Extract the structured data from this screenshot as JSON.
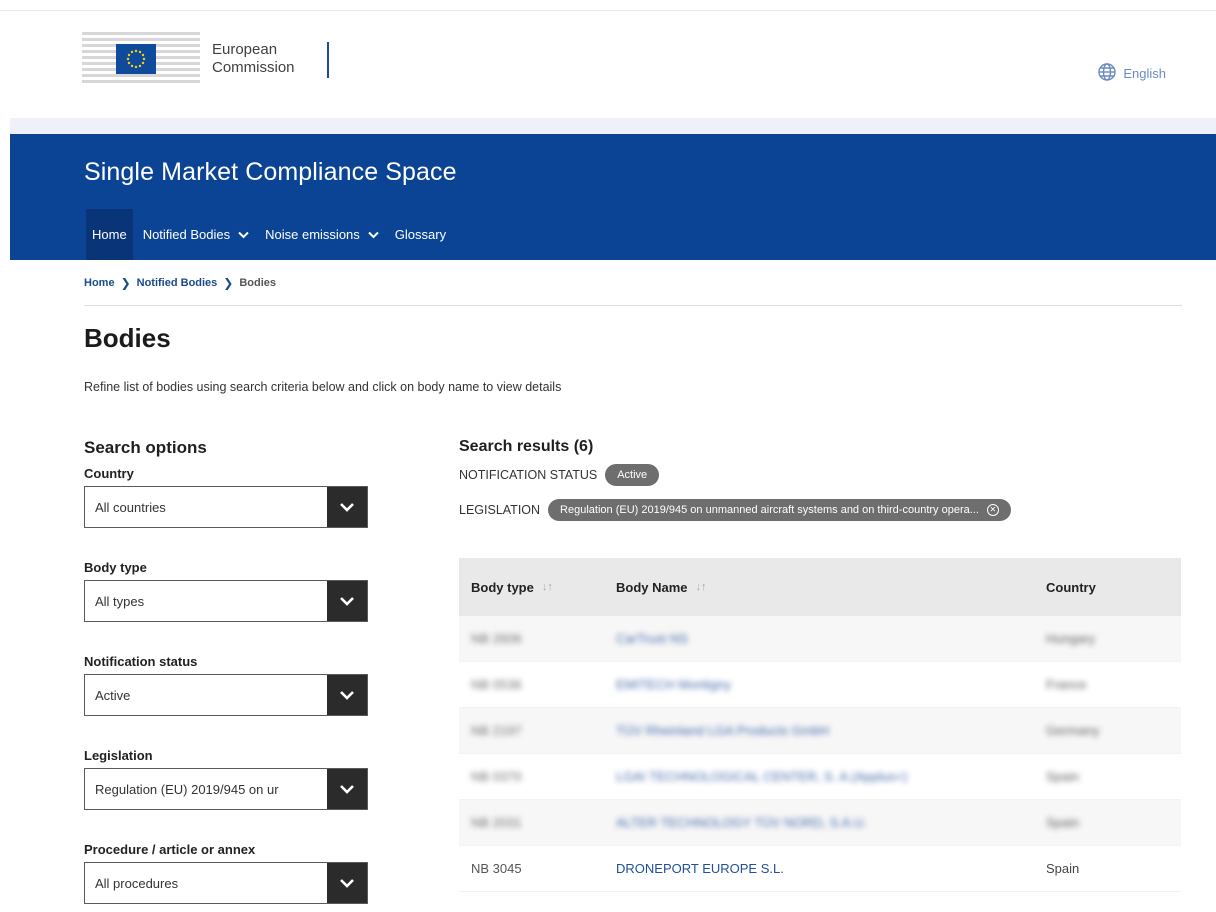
{
  "header": {
    "logo_line1": "European",
    "logo_line2": "Commission",
    "language": "English"
  },
  "banner": {
    "site_title": "Single Market Compliance Space",
    "nav": [
      {
        "label": "Home",
        "active": true,
        "dropdown": false
      },
      {
        "label": "Notified Bodies",
        "active": false,
        "dropdown": true
      },
      {
        "label": "Noise emissions",
        "active": false,
        "dropdown": true
      },
      {
        "label": "Glossary",
        "active": false,
        "dropdown": false
      }
    ]
  },
  "breadcrumb": {
    "items": [
      "Home",
      "Notified Bodies",
      "Bodies"
    ]
  },
  "page": {
    "title": "Bodies",
    "intro": "Refine list of bodies using search criteria below and click on body name to view details"
  },
  "search_options": {
    "title": "Search options",
    "fields": [
      {
        "label": "Country",
        "value": "All countries"
      },
      {
        "label": "Body type",
        "value": "All types"
      },
      {
        "label": "Notification status",
        "value": "Active"
      },
      {
        "label": "Legislation",
        "value": "Regulation (EU) 2019/945 on ur"
      },
      {
        "label": "Procedure / article or annex",
        "value": "All procedures"
      }
    ]
  },
  "results": {
    "title": "Search results (6)",
    "filters": [
      {
        "label": "NOTIFICATION STATUS",
        "chip": "Active",
        "removable": false
      },
      {
        "label": "LEGISLATION",
        "chip": "Regulation (EU) 2019/945 on unmanned aircraft systems and on third-country opera...",
        "removable": true
      }
    ],
    "columns": [
      "Body type",
      "Body Name",
      "Country"
    ],
    "rows": [
      {
        "type": "NB 2606",
        "name": "CarTrust NS",
        "country": "Hungary",
        "blurred": true
      },
      {
        "type": "NB 0536",
        "name": "EMITECH Montigny",
        "country": "France",
        "blurred": true
      },
      {
        "type": "NB 2197",
        "name": "TÜV Rheinland LGA Products GmbH",
        "country": "Germany",
        "blurred": true
      },
      {
        "type": "NB 0370",
        "name": "LGAI TECHNOLOGICAL CENTER, S. A.(Applus+)",
        "country": "Spain",
        "blurred": true
      },
      {
        "type": "NB 2031",
        "name": "ALTER TECHNOLOGY TÜV NORD, S.A.U.",
        "country": "Spain",
        "blurred": true
      },
      {
        "type": "NB 3045",
        "name": "DRONEPORT EUROPE S.L.",
        "country": "Spain",
        "blurred": false
      }
    ]
  },
  "colors": {
    "banner": "#0b4494",
    "nav_active": "#0a3478",
    "link": "#1f4f9a",
    "chip": "#6e6e6e",
    "select_button": "#2b2b2b"
  }
}
